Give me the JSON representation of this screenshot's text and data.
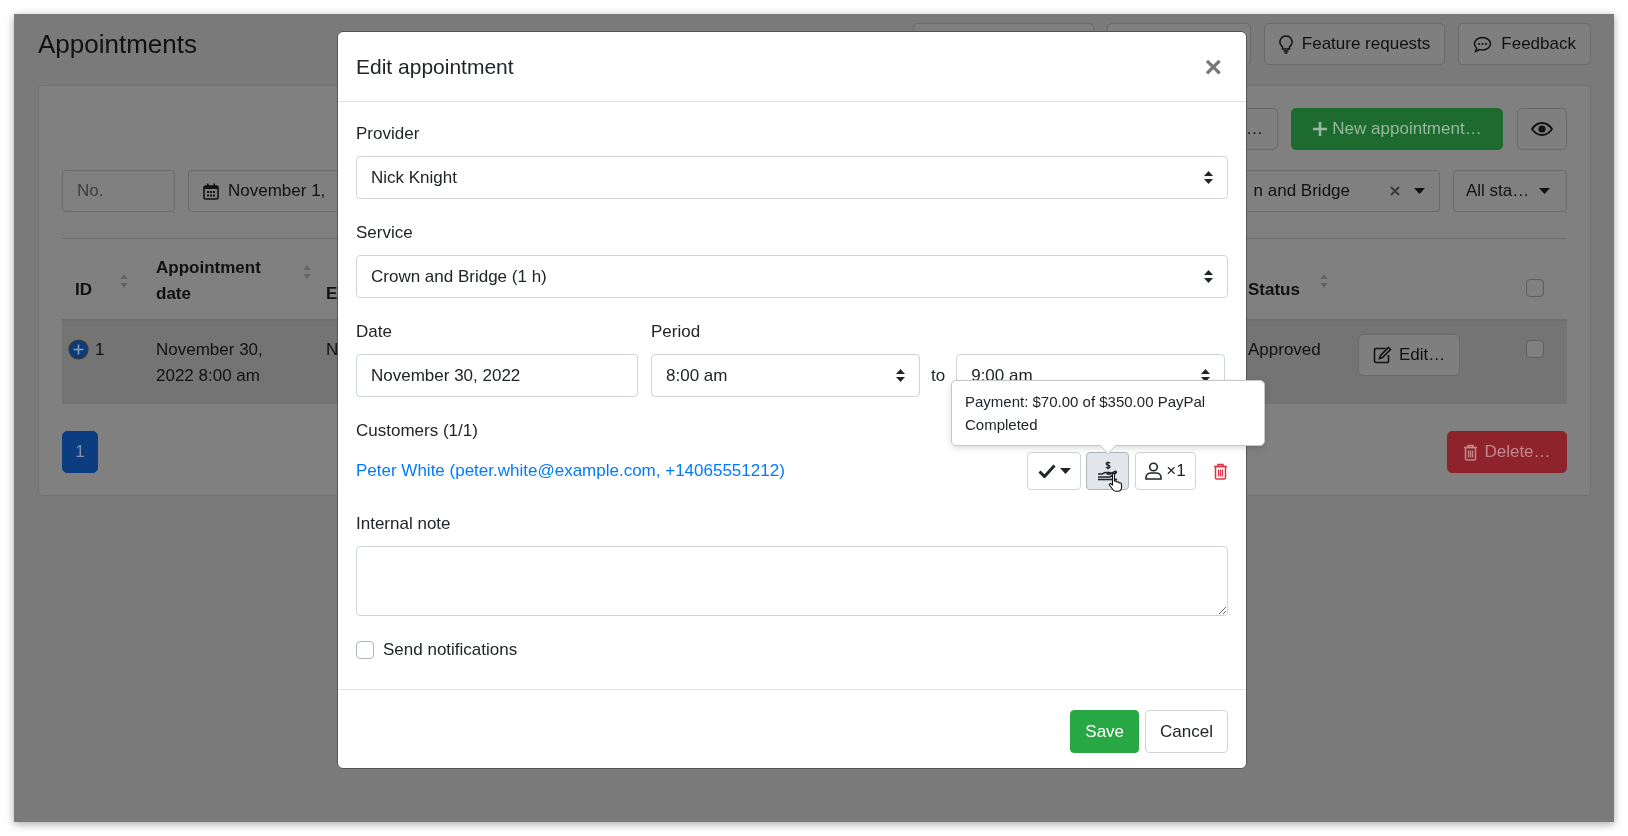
{
  "page": {
    "title": "Appointments",
    "header_buttons": [
      {
        "kind": "covered"
      },
      {
        "kind": "covered"
      },
      {
        "kind": "idea",
        "label": "Feature requests"
      },
      {
        "kind": "chat",
        "label": "Feedback"
      }
    ],
    "actions": [
      {
        "kind": "covered",
        "label": "…"
      },
      {
        "kind": "new",
        "label": "New appointment…"
      },
      {
        "kind": "eye"
      }
    ],
    "filters": [
      {
        "kind": "text",
        "placeholder": "No."
      },
      {
        "kind": "date",
        "value": "November 1,"
      },
      {
        "kind": "select",
        "value": "n and Bridge",
        "clearable": true
      },
      {
        "kind": "dropdown",
        "value": "All sta…"
      }
    ],
    "table": {
      "columns": [
        {
          "label": "ID",
          "sortable": true
        },
        {
          "label": "Appointment date",
          "sortable": true
        },
        {
          "label": "E"
        },
        {
          "label": "Status",
          "sortable": true
        },
        {
          "kind": "actions"
        },
        {
          "kind": "check",
          "checked": false
        }
      ],
      "rows": [
        {
          "highlighted": true,
          "expandable": true,
          "id": "1",
          "date": "November 30, 2022 8:00 am",
          "column_3": "N",
          "status": "Approved",
          "edit": "Edit…",
          "checked": false
        }
      ]
    },
    "pagination": [
      {
        "label": "1",
        "selected": true
      }
    ],
    "delete_button": "Delete…"
  },
  "modal": {
    "title": "Edit appointment",
    "close": "×",
    "provider": {
      "label": "Provider",
      "value": "Nick Knight"
    },
    "service": {
      "label": "Service",
      "value": "Crown and Bridge (1 h)"
    },
    "date": {
      "label": "Date",
      "value": "November 30, 2022"
    },
    "period": {
      "label": "Period",
      "start": "8:00 am",
      "separator": "to",
      "end": "9:00 am"
    },
    "customers": {
      "label": "Customers (1/1)",
      "items": [
        {
          "name": "Peter White (peter.white@example.com, +14065551212)",
          "pressed": true,
          "count": "×1",
          "tooltip": "Payment: $70.00 of $350.00 PayPal Completed"
        }
      ]
    },
    "note": {
      "label": "Internal note"
    },
    "send_notifications": {
      "label": "Send notifications",
      "checked": false
    },
    "buttons": [
      {
        "kind": "primary",
        "label": "Save"
      },
      {
        "kind": "secondary",
        "label": "Cancel"
      }
    ]
  }
}
